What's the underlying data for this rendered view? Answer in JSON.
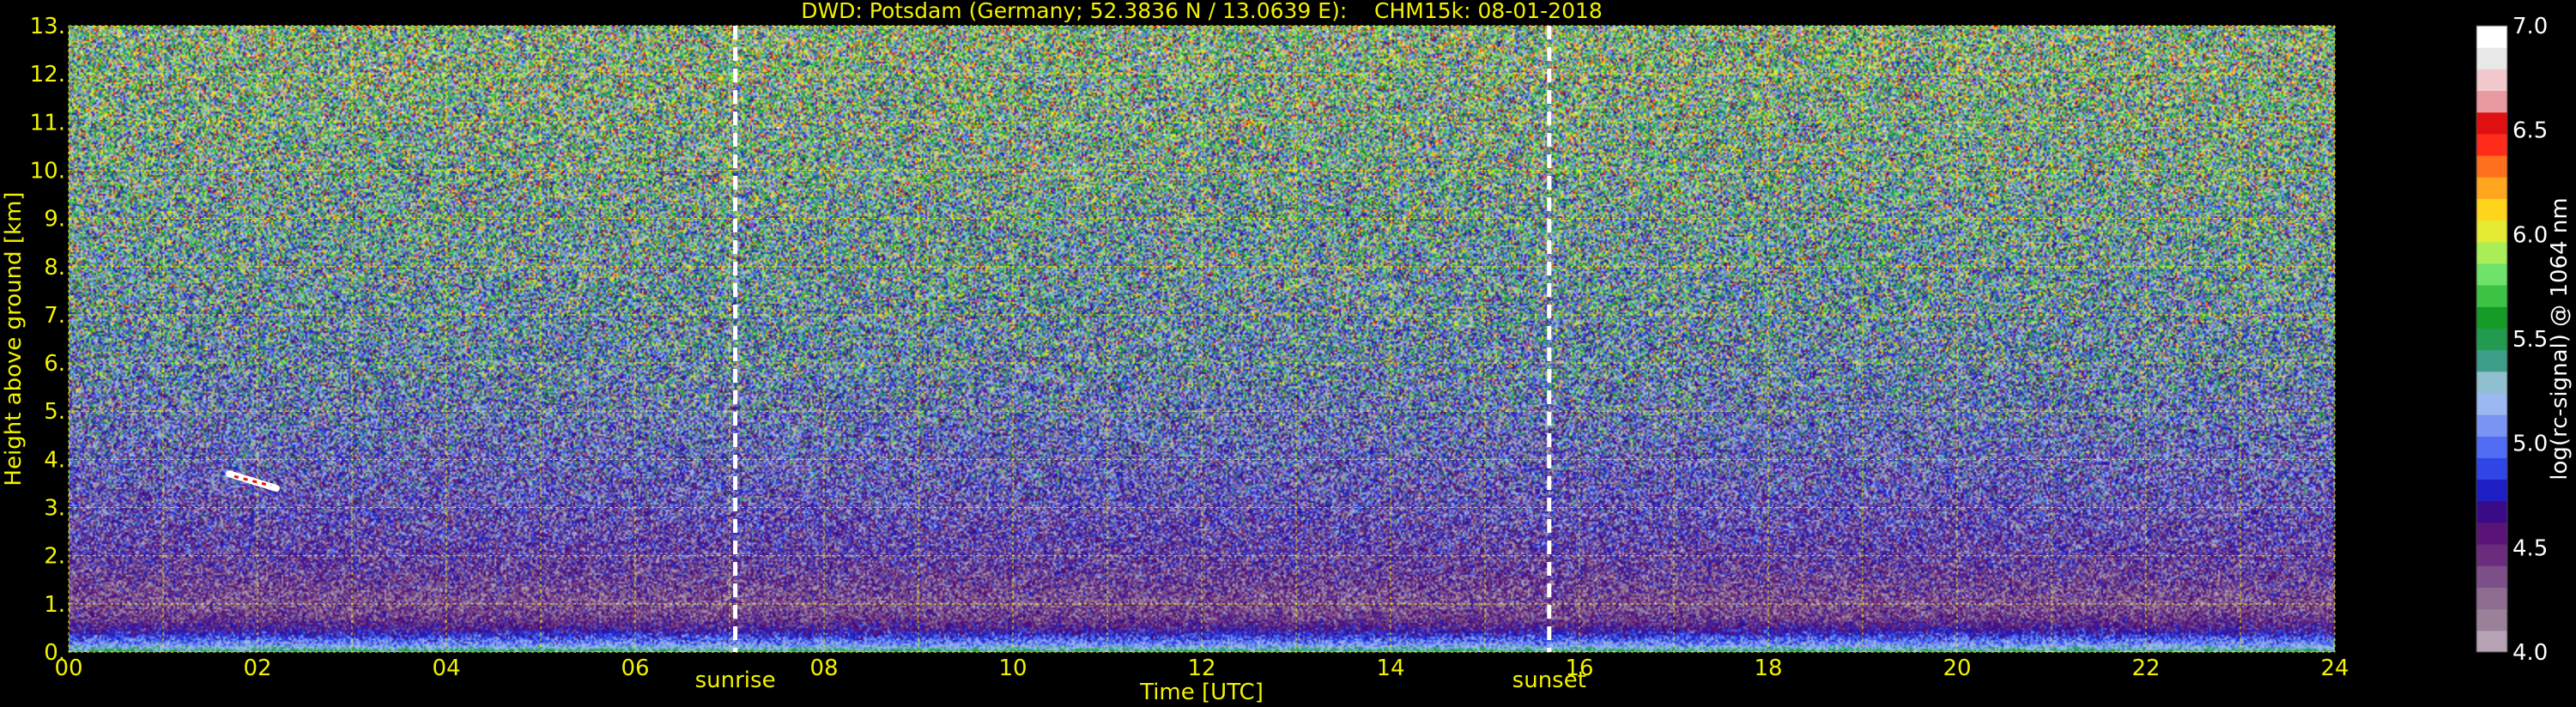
{
  "chart_data": {
    "type": "heatmap",
    "title": "DWD: Potsdam (Germany; 52.3836 N / 13.0639 E):    CHM15k: 08-01-2018",
    "xlabel": "Time [UTC]",
    "ylabel": "Height above ground [km]",
    "xlim": [
      0,
      24
    ],
    "ylim": [
      0,
      13
    ],
    "x_ticks": [
      "00",
      "02",
      "04",
      "06",
      "08",
      "10",
      "12",
      "14",
      "16",
      "18",
      "20",
      "22",
      "24"
    ],
    "y_ticks": [
      "0.",
      "1.",
      "2.",
      "3.",
      "4.",
      "5.",
      "6.",
      "7.",
      "8.",
      "9.",
      "10.",
      "11.",
      "12.",
      "13."
    ],
    "grid": true,
    "colorbar": {
      "label": "log(rc-signal) @ 1064 nm",
      "range": [
        4.0,
        7.0
      ],
      "ticks": [
        "4.0",
        "4.5",
        "5.0",
        "5.5",
        "6.0",
        "6.5",
        "7.0"
      ],
      "colors": [
        "#b6a2b4",
        "#9a8199",
        "#8e6c92",
        "#7d4f88",
        "#6a2d7e",
        "#5a1478",
        "#3a0b87",
        "#1d1ec4",
        "#2f45e6",
        "#4f6cf2",
        "#7b95f4",
        "#9bb8f2",
        "#8fbfd0",
        "#3c9d88",
        "#229a4f",
        "#149c26",
        "#3dc444",
        "#6fe26a",
        "#a9ee57",
        "#e6ea33",
        "#ffd51c",
        "#ffa51e",
        "#ff6e1c",
        "#ff2b1a",
        "#e01010",
        "#e89aa0",
        "#f2c9cc",
        "#e8e8e8",
        "#ffffff"
      ]
    },
    "annotations": [
      {
        "text": "sunrise",
        "x": 7.06
      },
      {
        "text": "sunset",
        "x": 15.68
      }
    ],
    "signal_profile": {
      "heights_km": [
        0.0,
        0.15,
        0.3,
        0.5,
        0.7,
        1.0,
        1.5,
        2.0,
        3.0,
        4.0,
        5.0,
        6.0,
        7.0,
        8.0,
        9.0,
        10.0,
        11.0,
        13.0
      ],
      "log_signal": [
        5.5,
        5.1,
        4.9,
        4.6,
        4.45,
        4.35,
        4.45,
        4.55,
        4.65,
        4.75,
        4.9,
        5.1,
        5.2,
        5.3,
        5.35,
        5.45,
        5.5,
        5.6
      ]
    },
    "features": [
      {
        "type": "cloud",
        "time": [
          1.7,
          2.2
        ],
        "height_km": [
          3.4,
          3.7
        ],
        "log_signal": 5.8
      }
    ]
  }
}
